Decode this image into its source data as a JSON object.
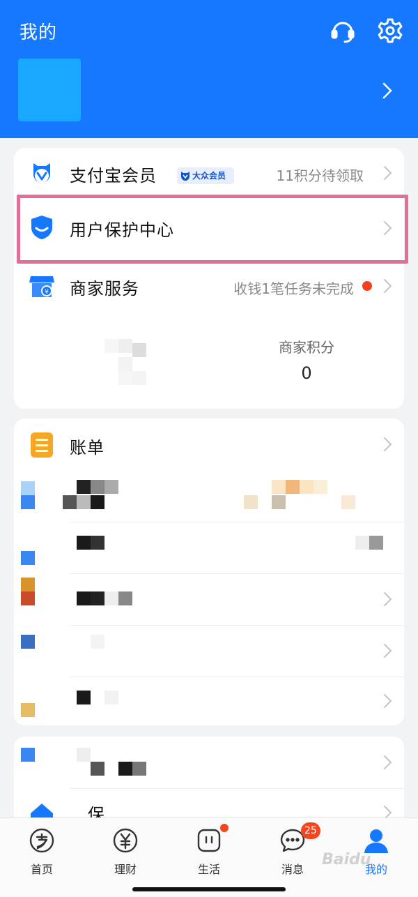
{
  "header": {
    "title": "我的",
    "support_icon": "customer-service-headset-icon",
    "settings_icon": "gear-icon",
    "colors": {
      "background": "#1677ff"
    }
  },
  "card1": {
    "rows": [
      {
        "label": "支付宝会员",
        "badge": "大众会员",
        "right_text": "11积分待领取",
        "icon": "alipay-member-icon"
      },
      {
        "label": "用户保护中心",
        "right_text": "",
        "icon": "shield-icon",
        "highlighted": true
      },
      {
        "label": "商家服务",
        "right_text": "收钱1笔任务未完成",
        "icon": "merchant-store-icon",
        "notification_dot": true
      }
    ],
    "merchant_points": {
      "title": "商家积分",
      "value": "0"
    }
  },
  "card2": {
    "rows": [
      {
        "label": "账单",
        "icon": "bill-icon"
      }
    ]
  },
  "card3": {
    "partial_label": "...保"
  },
  "tabbar": {
    "tabs": [
      {
        "label": "首页",
        "icon": "alipay-home-icon",
        "active": false
      },
      {
        "label": "理财",
        "icon": "yuan-coin-icon",
        "active": false
      },
      {
        "label": "生活",
        "icon": "life-icon",
        "active": false,
        "dot": true
      },
      {
        "label": "消息",
        "icon": "message-bubble-icon",
        "active": false,
        "badge": "25"
      },
      {
        "label": "我的",
        "icon": "person-icon",
        "active": true
      }
    ]
  },
  "watermark": "Baidu"
}
